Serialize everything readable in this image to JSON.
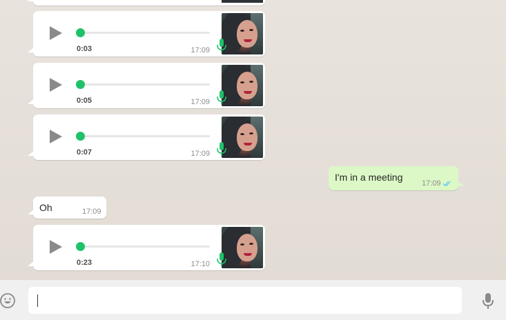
{
  "colors": {
    "chat_bg": "#e5ddd5",
    "incoming_bubble": "#ffffff",
    "outgoing_bubble": "#dcf8c6",
    "progress_knob": "#1fc26a",
    "mic_icon": "#1fc26a",
    "read_ticks": "#4fc3f7"
  },
  "messages": [
    {
      "type": "voice",
      "duration": "0:03",
      "time": "17:09",
      "progress": 0
    },
    {
      "type": "voice",
      "duration": "0:05",
      "time": "17:09",
      "progress": 0
    },
    {
      "type": "voice",
      "duration": "0:07",
      "time": "17:09",
      "progress": 0
    },
    {
      "type": "text",
      "direction": "out",
      "text": "I'm in a meeting",
      "time": "17:09",
      "status_icon": "double-check-icon"
    },
    {
      "type": "text",
      "direction": "in",
      "text": "Oh",
      "time": "17:09"
    },
    {
      "type": "voice",
      "duration": "0:23",
      "time": "17:10",
      "progress": 0
    }
  ],
  "composer": {
    "emoji_icon": "smiley-icon",
    "input_value": "",
    "mic_icon": "microphone-icon"
  }
}
